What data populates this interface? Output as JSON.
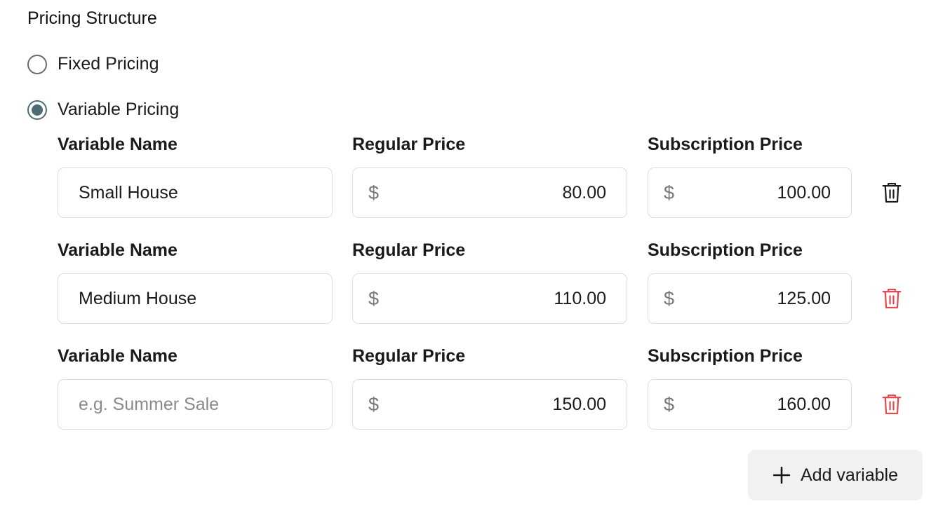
{
  "section_title": "Pricing Structure",
  "pricing_options": [
    {
      "label": "Fixed Pricing",
      "selected": false
    },
    {
      "label": "Variable Pricing",
      "selected": true
    }
  ],
  "labels": {
    "variable_name": "Variable Name",
    "regular_price": "Regular Price",
    "subscription_price": "Subscription Price"
  },
  "currency_symbol": "$",
  "variables": [
    {
      "name": "Small House",
      "placeholder": "e.g. Summer Sale",
      "regular_price": "80.00",
      "subscription_price": "100.00",
      "delete_icon_color": "#1a1a1a"
    },
    {
      "name": "Medium House",
      "placeholder": "e.g. Summer Sale",
      "regular_price": "110.00",
      "subscription_price": "125.00",
      "delete_icon_color": "#e5484d"
    },
    {
      "name": "",
      "placeholder": "e.g. Summer Sale",
      "regular_price": "150.00",
      "subscription_price": "160.00",
      "delete_icon_color": "#e5484d"
    }
  ],
  "add_button": {
    "label": "Add variable",
    "icon": "plus-icon"
  },
  "colors": {
    "accent": "#4d6b72",
    "danger": "#e5484d",
    "button_bg": "#f1f1f1"
  }
}
